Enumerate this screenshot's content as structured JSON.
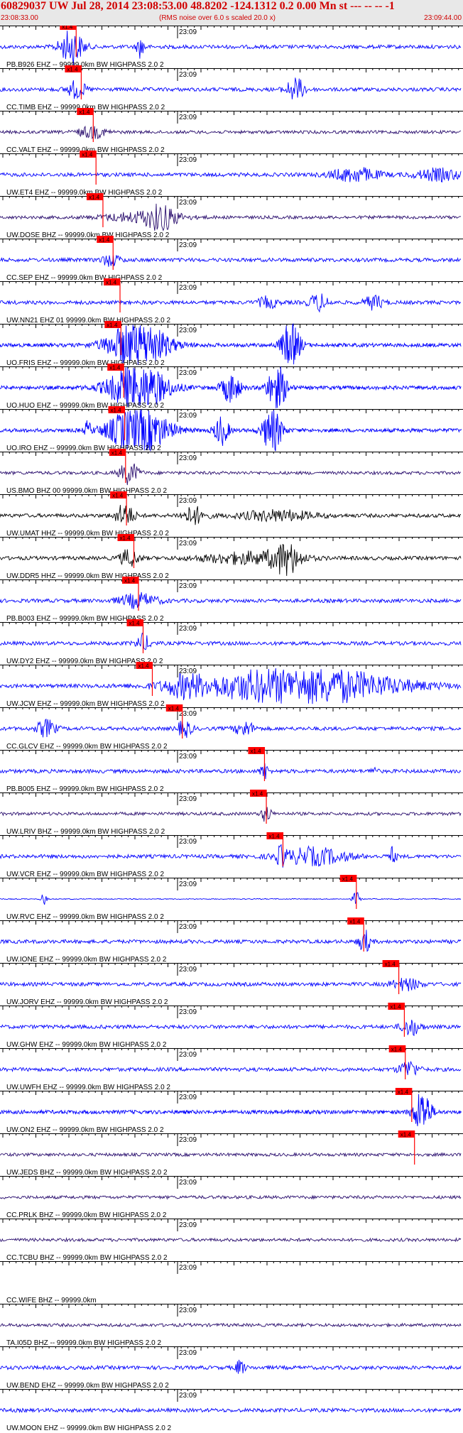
{
  "header": {
    "title": "60829037 UW Jul 28, 2014 23:08:53.00   48.8202  -124.1312  0.2 0.00 Mn st --- -- --  -1",
    "start_time": "23:08:33.00",
    "note": "(RMS noise over 6.0 s scaled 20.0 x)",
    "end_time": "23:09:44.00"
  },
  "colors": {
    "blue": "#0000ff",
    "dark": "#2a0e6e",
    "black": "#000000",
    "pick": "#ff0000",
    "header_text": "#d00000"
  },
  "chart_data": {
    "type": "line",
    "title": "60829037 UW Jul 28, 2014 23:08:53.00   48.8202  -124.1312  0.2 0.00 Mn st --- -- --  -1",
    "x_time_range": [
      "23:08:33.00",
      "23:09:44.00"
    ],
    "minute_mark": "23:09",
    "pick_label": "x1.4",
    "traces": [
      {
        "label": "PB.B926 EHZ -- 99999.0km BW  HIGHPASS  2.0  2",
        "color": "blue",
        "pick_frac": 0.165,
        "bursts": [
          [
            0.155,
            0.025,
            6
          ],
          [
            0.305,
            0.008,
            4
          ]
        ]
      },
      {
        "label": "CC.TIMB EHZ -- 99999.0km BW  HIGHPASS  2.0  2",
        "color": "blue",
        "pick_frac": 0.176,
        "bursts": [
          [
            0.165,
            0.02,
            3
          ],
          [
            0.64,
            0.02,
            4
          ]
        ]
      },
      {
        "label": "CC.VALT EHZ -- 99999.0km BW  HIGHPASS  2.0  2",
        "color": "dark",
        "pick_frac": 0.202,
        "bursts": [
          [
            0.2,
            0.03,
            2
          ]
        ]
      },
      {
        "label": "UW.ET4 EHZ -- 99999.0km BW  HIGHPASS  2.0  2",
        "color": "blue",
        "pick_frac": 0.208,
        "bursts": [
          [
            0.77,
            0.05,
            2.5
          ],
          [
            0.95,
            0.05,
            2
          ]
        ]
      },
      {
        "label": "UW.DOSE BHZ -- 99999.0km BW  HIGHPASS  2.0  2",
        "color": "dark",
        "pick_frac": 0.223,
        "bursts": [
          [
            0.35,
            0.03,
            3.5
          ],
          [
            0.31,
            0.08,
            1.8
          ]
        ]
      },
      {
        "label": "CC.SEP EHZ -- 99999.0km BW  HIGHPASS  2.0  2",
        "color": "blue",
        "pick_frac": 0.245,
        "bursts": [
          [
            0.24,
            0.02,
            2
          ]
        ]
      },
      {
        "label": "UW.NN21 EHZ 01 99999.0km BW  HIGHPASS  2.0  2",
        "color": "blue",
        "pick_frac": 0.26,
        "bursts": [
          [
            0.69,
            0.02,
            3
          ],
          [
            0.81,
            0.02,
            2.5
          ],
          [
            0.58,
            0.02,
            2
          ]
        ]
      },
      {
        "label": "UO.FRIS EHZ -- 99999.0km BW  HIGHPASS  2.0  2",
        "color": "blue",
        "pick_frac": 0.262,
        "bursts": [
          [
            0.3,
            0.06,
            9
          ],
          [
            0.63,
            0.02,
            8
          ]
        ],
        "clip": true
      },
      {
        "label": "UO.HUO EHZ -- 99999.0km BW  HIGHPASS  2.0  2",
        "color": "blue",
        "pick_frac": 0.268,
        "bursts": [
          [
            0.3,
            0.06,
            9
          ],
          [
            0.5,
            0.02,
            5
          ],
          [
            0.6,
            0.02,
            8
          ]
        ],
        "clip": true
      },
      {
        "label": "UO.IRO EHZ -- 99999.0km BW  HIGHPASS  2.0  2",
        "color": "blue",
        "pick_frac": 0.27,
        "bursts": [
          [
            0.3,
            0.06,
            9
          ],
          [
            0.48,
            0.015,
            5
          ],
          [
            0.59,
            0.02,
            8
          ],
          [
            0.19,
            0.006,
            3
          ]
        ],
        "clip": true
      },
      {
        "label": "US.BMO BHZ 00 99999.0km BW  HIGHPASS  2.0  2",
        "color": "dark",
        "pick_frac": 0.272,
        "bursts": [
          [
            0.28,
            0.02,
            4
          ]
        ]
      },
      {
        "label": "UW.UMAT HHZ -- 99999.0km BW  HIGHPASS  2.0  2",
        "color": "black",
        "pick_frac": 0.274,
        "bursts": [
          [
            0.27,
            0.02,
            4
          ],
          [
            0.42,
            0.025,
            3
          ],
          [
            0.6,
            0.08,
            1.8
          ]
        ]
      },
      {
        "label": "UW.DDR5 HHZ -- 99999.0km BW  HIGHPASS  2.0  2",
        "color": "black",
        "pick_frac": 0.29,
        "bursts": [
          [
            0.62,
            0.03,
            5
          ],
          [
            0.54,
            0.1,
            2
          ],
          [
            0.28,
            0.02,
            3
          ]
        ]
      },
      {
        "label": "PB.B003 EHZ -- 99999.0km BW  HIGHPASS  2.0  2",
        "color": "blue",
        "pick_frac": 0.3,
        "bursts": [
          [
            0.3,
            0.04,
            2.5
          ]
        ]
      },
      {
        "label": "UW.DY2 EHZ -- 99999.0km BW  HIGHPASS  2.0  2",
        "color": "blue",
        "pick_frac": 0.31,
        "bursts": [
          [
            0.31,
            0.015,
            3
          ]
        ]
      },
      {
        "label": "UW.JCW EHZ -- 99999.0km BW  HIGHPASS  2.0  2",
        "color": "blue",
        "pick_frac": 0.33,
        "bursts": [
          [
            0.65,
            0.2,
            7
          ],
          [
            0.4,
            0.04,
            3
          ]
        ]
      },
      {
        "label": "CC.GLCV EHZ -- 99999.0km BW  HIGHPASS  2.0  2",
        "color": "blue",
        "pick_frac": 0.395,
        "bursts": [
          [
            0.1,
            0.02,
            3
          ],
          [
            0.4,
            0.015,
            3
          ],
          [
            0.53,
            0.02,
            2.5
          ]
        ]
      },
      {
        "label": "PB.B005 EHZ -- 99999.0km BW  HIGHPASS  2.0  2",
        "color": "blue",
        "pick_frac": 0.573,
        "bursts": [
          [
            0.573,
            0.008,
            3
          ],
          [
            0.81,
            0.006,
            2
          ]
        ]
      },
      {
        "label": "UW.LRIV BHZ -- 99999.0km BW  HIGHPASS  2.0  2",
        "color": "dark",
        "pick_frac": 0.577,
        "bursts": [
          [
            0.577,
            0.01,
            3
          ]
        ]
      },
      {
        "label": "UW.VCR EHZ -- 99999.0km BW  HIGHPASS  2.0  2",
        "color": "blue",
        "pick_frac": 0.613,
        "bursts": [
          [
            0.68,
            0.07,
            3
          ],
          [
            0.85,
            0.008,
            3
          ],
          [
            0.61,
            0.01,
            3
          ]
        ]
      },
      {
        "label": "UW.RVC EHZ -- 99999.0km BW  HIGHPASS  2.0  2",
        "color": "blue",
        "pick_frac": 0.772,
        "bursts": [
          [
            0.772,
            0.008,
            2.5
          ],
          [
            0.095,
            0.006,
            2
          ]
        ],
        "quiet": true
      },
      {
        "label": "UW.IONE EHZ -- 99999.0km BW  HIGHPASS  2.0  2",
        "color": "blue",
        "pick_frac": 0.788,
        "bursts": [
          [
            0.79,
            0.012,
            4
          ]
        ]
      },
      {
        "label": "UW.JORV EHZ -- 99999.0km BW  HIGHPASS  2.0  2",
        "color": "blue",
        "pick_frac": 0.864,
        "bursts": [
          [
            0.88,
            0.03,
            2
          ]
        ]
      },
      {
        "label": "UW.GHW EHZ -- 99999.0km BW  HIGHPASS  2.0  2",
        "color": "blue",
        "pick_frac": 0.876,
        "bursts": [
          [
            0.89,
            0.02,
            3
          ]
        ]
      },
      {
        "label": "UW.UWFH EHZ -- 99999.0km BW  HIGHPASS  2.0  2",
        "color": "blue",
        "pick_frac": 0.878,
        "bursts": [
          [
            0.885,
            0.02,
            3
          ]
        ]
      },
      {
        "label": "UW.ON2 EHZ -- 99999.0km BW  HIGHPASS  2.0  2",
        "color": "blue",
        "pick_frac": 0.892,
        "bursts": [
          [
            0.915,
            0.018,
            8
          ]
        ],
        "clip": true
      },
      {
        "label": "UW.JEDS BHZ -- 99999.0km BW  HIGHPASS  2.0  2",
        "color": "dark",
        "pick_frac": 0.898,
        "bursts": []
      },
      {
        "label": "CC.PRLK BHZ -- 99999.0km BW  HIGHPASS  2.0  2",
        "color": "dark",
        "pick_frac": null,
        "bursts": []
      },
      {
        "label": "CC.TCBU BHZ -- 99999.0km BW  HIGHPASS  2.0  2",
        "color": "dark",
        "pick_frac": null,
        "bursts": []
      },
      {
        "label": "CC.WIFE BHZ -- 99999.0km",
        "color": "none",
        "pick_frac": null,
        "bursts": []
      },
      {
        "label": "TA.I05D BHZ -- 99999.0km BW  HIGHPASS  2.0  2",
        "color": "dark",
        "pick_frac": null,
        "bursts": []
      },
      {
        "label": "UW.BEND EHZ -- 99999.0km BW  HIGHPASS  2.0  2",
        "color": "blue",
        "pick_frac": null,
        "bursts": [
          [
            0.52,
            0.01,
            2.5
          ]
        ]
      },
      {
        "label": "UW.MOON EHZ -- 99999.0km BW  HIGHPASS  2.0  2",
        "color": "blue",
        "pick_frac": null,
        "bursts": []
      }
    ]
  }
}
